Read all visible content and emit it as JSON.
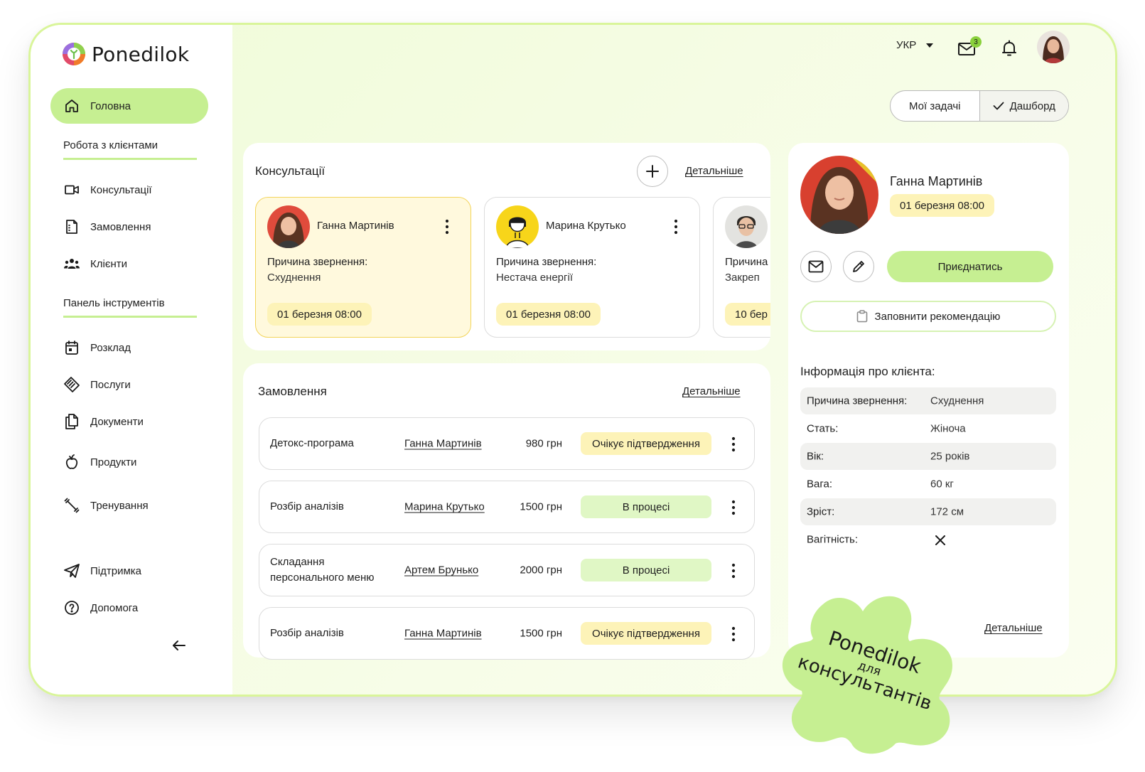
{
  "brand": {
    "name": "Ponedilok"
  },
  "sidebar": {
    "home": "Головна",
    "section_clients": "Робота з клієнтами",
    "items_clients": [
      "Консультації",
      "Замовлення",
      "Клієнти"
    ],
    "section_tools": "Панель інструментів",
    "items_tools": [
      "Розклад",
      "Послуги",
      "Документи",
      "Продукти",
      "Тренування"
    ],
    "support": "Підтримка",
    "help": "Допомога"
  },
  "topbar": {
    "language": "УКР",
    "mail_count": "3"
  },
  "view_toggle": {
    "my_tasks": "Мої задачі",
    "dashboard": "Дашборд"
  },
  "consultations": {
    "title": "Консультації",
    "details": "Детальніше",
    "cards": [
      {
        "name": "Ганна Мартинів",
        "reason_label": "Причина звернення:",
        "reason": "Схуднення",
        "date": "01 березня 08:00"
      },
      {
        "name": "Марина Крутько",
        "reason_label": "Причина звернення:",
        "reason": "Нестача енергії",
        "date": "01 березня 08:00"
      },
      {
        "name": "",
        "reason_label": "Причина звернення:",
        "reason": "Закреп",
        "date": "10 бер"
      }
    ]
  },
  "orders": {
    "title": "Замовлення",
    "details": "Детальніше",
    "rows": [
      {
        "service": "Детокс-програма",
        "client": "Ганна Мартинів",
        "price": "980 грн",
        "status": "Очікує підтвердження"
      },
      {
        "service": "Розбір аналізів",
        "client": "Марина Крутько",
        "price": "1500 грн",
        "status": "В процесі"
      },
      {
        "service": "Складання персонального меню",
        "client": "Артем Брунько",
        "price": "2000 грн",
        "status": "В процесі"
      },
      {
        "service": "Розбір аналізів",
        "client": "Ганна Мартинів",
        "price": "1500 грн",
        "status": "Очікує підтвердження"
      }
    ]
  },
  "profile": {
    "name": "Ганна Мартинів",
    "date": "01 березня 08:00",
    "join": "Приєднатись",
    "recommend": "Заповнити рекомендацію",
    "info_title": "Інформація про клієнта:",
    "fields": [
      {
        "label": "Причина звернення:",
        "value": "Схуднення"
      },
      {
        "label": "Стать:",
        "value": "Жіноча"
      },
      {
        "label": "Вік:",
        "value": "25 років"
      },
      {
        "label": "Вага:",
        "value": "60 кг"
      },
      {
        "label": "Зріст:",
        "value": "172 см"
      },
      {
        "label": "Вагітність:",
        "value": ""
      }
    ],
    "details": "Детальніше"
  },
  "promo": {
    "line1": "Ponedilok",
    "line2": "для",
    "line3": "консультантів"
  },
  "colors": {
    "accent_green": "#c6ef92",
    "badge_yellow": "#fdf3b8",
    "progress_green": "#e0f7c5",
    "frame_border": "#d9f59a"
  }
}
